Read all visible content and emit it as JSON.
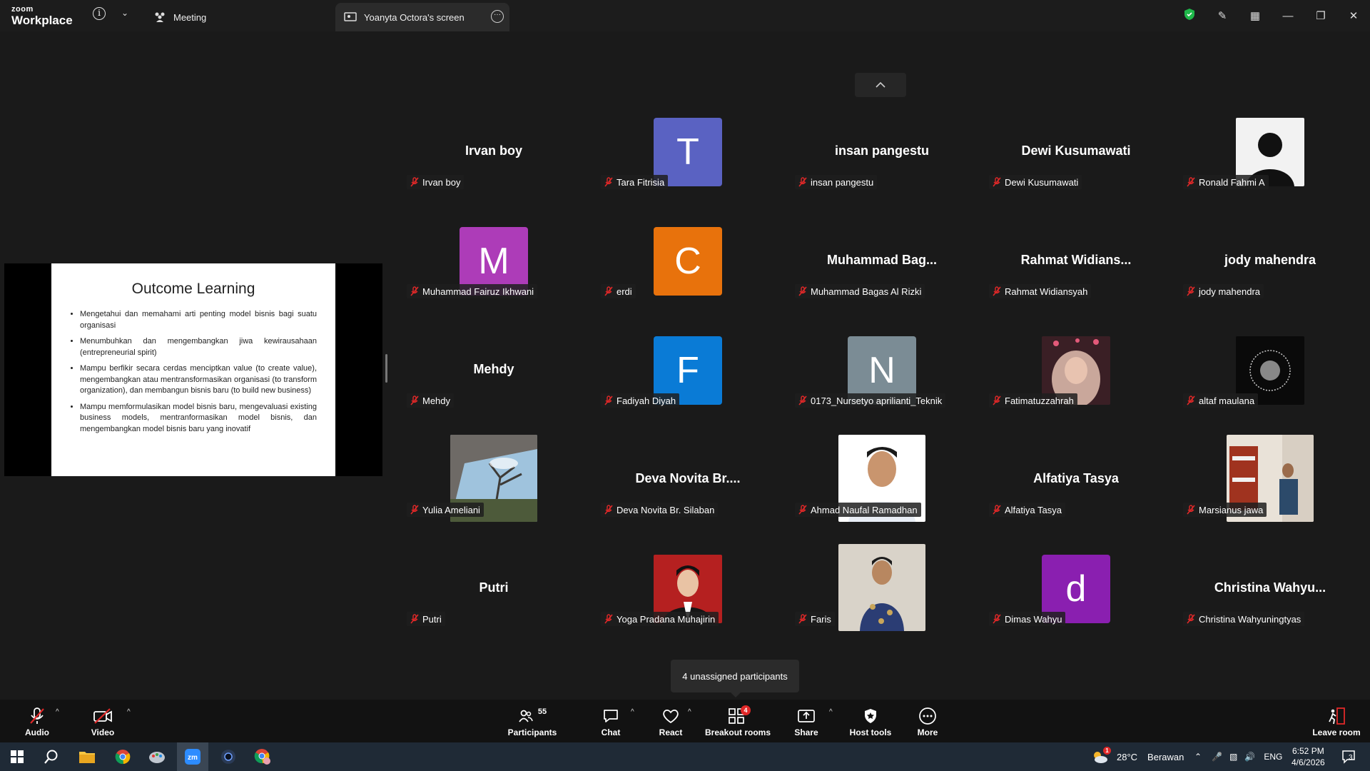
{
  "titlebar": {
    "brand_top": "zoom",
    "brand_bottom": "Workplace",
    "tab_meeting": "Meeting",
    "tab_screen": "Yoanyta Octora's screen"
  },
  "share": {
    "slide_title": "Outcome Learning",
    "bullets": [
      "Mengetahui dan memahami arti penting model bisnis bagi suatu organisasi",
      "Menumbuhkan dan mengembangkan jiwa kewirausahaan (entrepreneurial spirit)",
      "Mampu berfikir secara cerdas menciptkan value (to create value), mengembangkan atau mentransformasikan organisasi (to transform organization), dan membangun bisnis baru (to build new business)",
      "Mampu memformulasikan model bisnis baru, mengevaluasi existing business models, mentranformasikan model bisnis, dan mengembangkan model bisnis baru yang inovatif"
    ]
  },
  "participants": [
    {
      "label": "Irvan boy",
      "big": "Irvan boy"
    },
    {
      "label": "Tara Fitrisia",
      "avatar": "T",
      "color": "#5a62c2"
    },
    {
      "label": "insan pangestu",
      "big": "insan pangestu"
    },
    {
      "label": "Dewi Kusumawati",
      "big": "Dewi Kusumawati"
    },
    {
      "label": "Ronald Fahmi A",
      "photo": "default-user"
    },
    {
      "label": "Muhammad Fairuz Ikhwani",
      "avatar": "M",
      "color": "#ad3cb8"
    },
    {
      "label": "erdi",
      "avatar": "C",
      "color": "#e8720c"
    },
    {
      "label": "Muhammad Bagas Al Rizki",
      "big": "Muhammad  Bag..."
    },
    {
      "label": "Rahmat Widiansyah",
      "big": "Rahmat  Widians..."
    },
    {
      "label": "jody mahendra",
      "big": "jody mahendra"
    },
    {
      "label": "Mehdy",
      "big": "Mehdy"
    },
    {
      "label": "Fadiyah Diyah",
      "avatar": "F",
      "color": "#0a7bd6"
    },
    {
      "label": "0173_Nursetyo aprilianti_Teknik",
      "avatar": "N",
      "color": "#7b8c95"
    },
    {
      "label": "Fatimatuzzahrah",
      "photo": "hijab-girl"
    },
    {
      "label": "altaf maulana",
      "photo": "dark-logo"
    },
    {
      "label": "Yulia Ameliani",
      "photo": "sky-window"
    },
    {
      "label": "Deva Novita Br. Silaban",
      "big": "Deva  Novita  Br...."
    },
    {
      "label": "Ahmad Naufal Ramadhan",
      "photo": "white-shirt-man"
    },
    {
      "label": "Alfatiya Tasya",
      "big": "Alfatiya Tasya"
    },
    {
      "label": "Marsianus jawa",
      "photo": "room-man"
    },
    {
      "label": "Putri",
      "big": "Putri"
    },
    {
      "label": "Yoga Pradana Muhajirin",
      "photo": "red-bg-man"
    },
    {
      "label": "Faris",
      "photo": "batik-man"
    },
    {
      "label": "Dimas Wahyu",
      "avatar": "d",
      "color": "#8a1fb0"
    },
    {
      "label": "Christina Wahyuningtyas",
      "big": "Christina  Wahyu..."
    }
  ],
  "tooltip": "4 unassigned participants",
  "toolbar": {
    "audio": "Audio",
    "video": "Video",
    "participants": "Participants",
    "participants_count": "55",
    "chat": "Chat",
    "react": "React",
    "breakout": "Breakout rooms",
    "breakout_badge": "4",
    "share": "Share",
    "host_tools": "Host tools",
    "more": "More",
    "leave": "Leave room"
  },
  "taskbar": {
    "weather_temp": "28°C",
    "weather_text": "Berawan",
    "weather_badge": "1",
    "lang": "ENG",
    "time": "6:52 PM",
    "date": "4/6/2026",
    "notif_count": "3"
  }
}
